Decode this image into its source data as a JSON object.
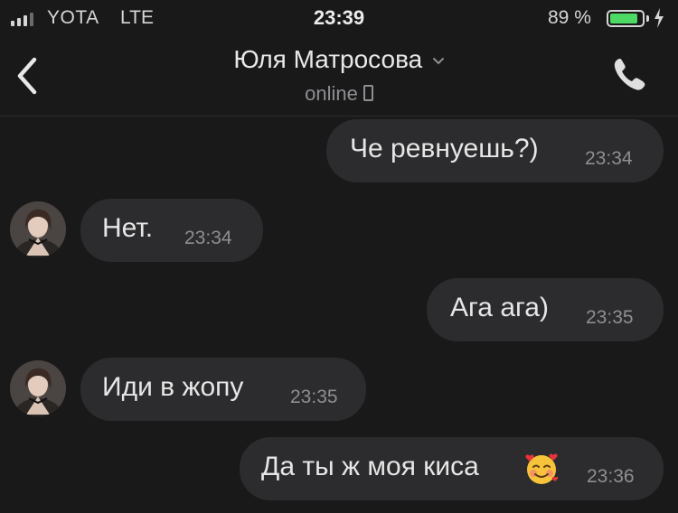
{
  "status_bar": {
    "carrier": "YOTA",
    "network": "LTE",
    "time": "23:39",
    "battery_percent": "89 %",
    "battery_level": 0.89,
    "battery_color": "#4cd964"
  },
  "header": {
    "back_icon": "chevron-left-icon",
    "contact_name": "Юля Матросова",
    "status": "online",
    "call_icon": "phone-icon"
  },
  "messages": [
    {
      "direction": "outgoing",
      "text": "Че ревнуешь?)",
      "time": "23:34"
    },
    {
      "direction": "incoming",
      "text": "Нет.",
      "time": "23:34"
    },
    {
      "direction": "outgoing",
      "text": "Ага ага)",
      "time": "23:35"
    },
    {
      "direction": "incoming",
      "text": "Иди в жопу",
      "time": "23:35"
    },
    {
      "direction": "outgoing",
      "text": "Да ты ж моя киса",
      "emoji": "smiling-face-with-hearts",
      "time": "23:36"
    }
  ],
  "colors": {
    "background": "#19191a",
    "bubble": "#2c2c2e",
    "secondary_text": "#8e8e93"
  }
}
